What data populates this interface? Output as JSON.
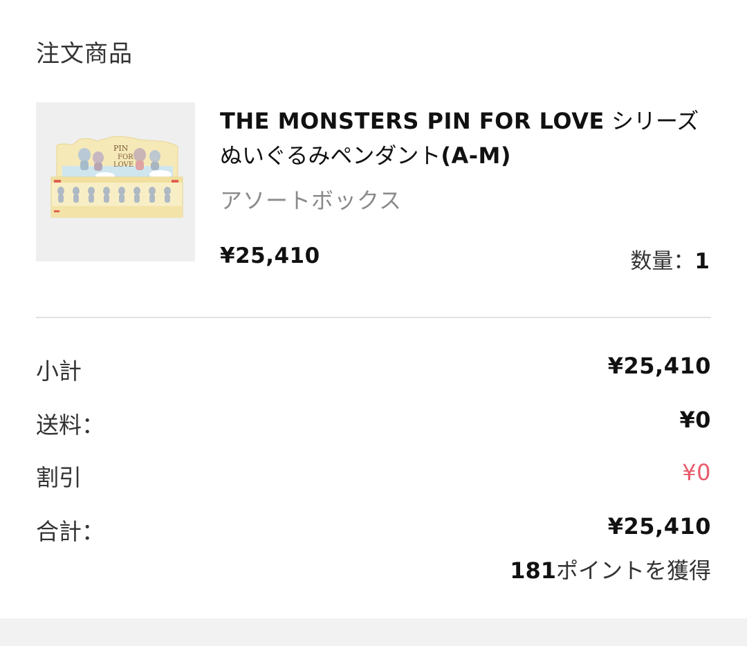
{
  "section": {
    "title": "注文商品"
  },
  "product": {
    "name_latin": "THE MONSTERS PIN FOR LOVE",
    "name_jp_1": "シリーズ",
    "name_jp_2": "ぬいぐるみペンダント",
    "name_latin_2": "(A-M)",
    "variant": "アソートボックス",
    "price": "¥25,410",
    "quantity_label": "数量：",
    "quantity_value": "1",
    "image": {
      "icon": "product-box-image",
      "box_text": "PIN FOR LOVE",
      "colors": {
        "background": "#efefef",
        "box": "#f6e9b8",
        "box_dark": "#ecd98e",
        "accent": "#e06050"
      }
    }
  },
  "summary": {
    "subtotal_label": "小計",
    "subtotal_value": "¥25,410",
    "shipping_label": "送料：",
    "shipping_value": "¥0",
    "discount_label": "割引",
    "discount_value": "¥0",
    "total_label": "合計：",
    "total_value": "¥25,410",
    "points_number": "181",
    "points_text": "ポイントを獲得"
  },
  "colors": {
    "discount": "#e85a6a",
    "divider": "#e2e2e2",
    "footer": "#f2f2f2"
  }
}
